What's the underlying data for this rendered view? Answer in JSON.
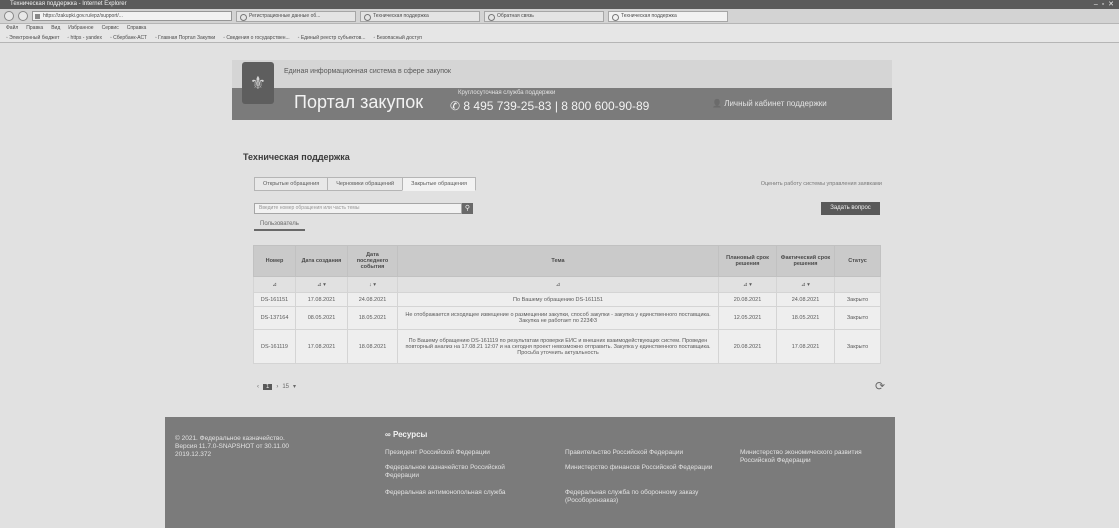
{
  "browser": {
    "title": "Техническая поддержка - Internet Explorer",
    "url": "https://zakupki.gov.ru/epz/support/...",
    "tabs": [
      "Регистрационные данные об...",
      "Техническая поддержка",
      "Обратная связь",
      "Техническая поддержка"
    ],
    "menu": [
      "Файл",
      "Правка",
      "Вид",
      "Избранное",
      "Сервис",
      "Справка"
    ],
    "favorites": [
      "Электронный бюджет",
      "https - yandex",
      "Сбербанк-АСТ",
      "Главная Портал Закупки",
      "Сведения о государствен...",
      "Единый реестр субъектов...",
      "Безопасный доступ"
    ]
  },
  "header": {
    "tagline": "Единая информационная система в сфере закупок",
    "portal_name": "Портал закупок",
    "hotline_caption": "Круглосуточная служба поддержки",
    "phone1": "8 495 739-25-83",
    "phone_sep": "|",
    "phone2": "8 800 600-90-89",
    "cabinet": "Личный кабинет поддержки"
  },
  "support": {
    "title": "Техническая поддержка",
    "tabs": [
      "Открытые обращения",
      "Черновики обращений",
      "Закрытые обращения"
    ],
    "rate_link": "Оценить работу системы управления заявками",
    "search_placeholder": "Введите номер обращения или часть темы",
    "new_request": "Задать вопрос",
    "user_tab": "Пользователь"
  },
  "table": {
    "headers": [
      "Номер",
      "Дата создания",
      "Дата последнего события",
      "Тема",
      "Плановый срок решения",
      "Фактический срок решения",
      "Статус"
    ],
    "rows": [
      {
        "num": "DS-161151",
        "created": "17.08.2021",
        "last": "24.08.2021",
        "topic": "По Вашему обращению DS-161151",
        "plan": "20.08.2021",
        "fact": "24.08.2021",
        "status": "Закрыто"
      },
      {
        "num": "DS-137164",
        "created": "08.05.2021",
        "last": "18.05.2021",
        "topic": "Не отображается исходящее извещение о размещении закупки, способ закупки - закупка у единственного поставщика. Закупка не работает по 223ФЗ",
        "plan": "12.05.2021",
        "fact": "18.05.2021",
        "status": "Закрыто"
      },
      {
        "num": "DS-161119",
        "created": "17.08.2021",
        "last": "18.08.2021",
        "topic": "По Вашему обращению DS-161119 по результатам проверки ЕИС и внешних взаимодействующих систем. Проведен повторный анализ на 17.08.21 12:07 и на сегодня проект невозможно отправить. Закупка у единственного поставщика. Просьба уточнить актуальность",
        "plan": "20.08.2021",
        "fact": "17.08.2021",
        "status": "Закрыто"
      }
    ]
  },
  "paging": {
    "prev": "‹",
    "current": "1",
    "next": "›",
    "per_page": "15"
  },
  "footer": {
    "copyright": "© 2021. Федеральное казначейство. Версия 11.7.0-SNAPSHOT от 30.11.00 2019.12.372",
    "resources_title": "Ресурсы",
    "links": [
      "Президент Российской Федерации",
      "Правительство Российской Федерации",
      "Министерство экономического развития Российской Федерации",
      "Федеральное казначейство Российской Федерации",
      "Министерство финансов Российской Федерации",
      "Федеральная антимонопольная служба",
      "Федеральная служба по оборонному заказу (Рособоронзаказ)"
    ]
  }
}
